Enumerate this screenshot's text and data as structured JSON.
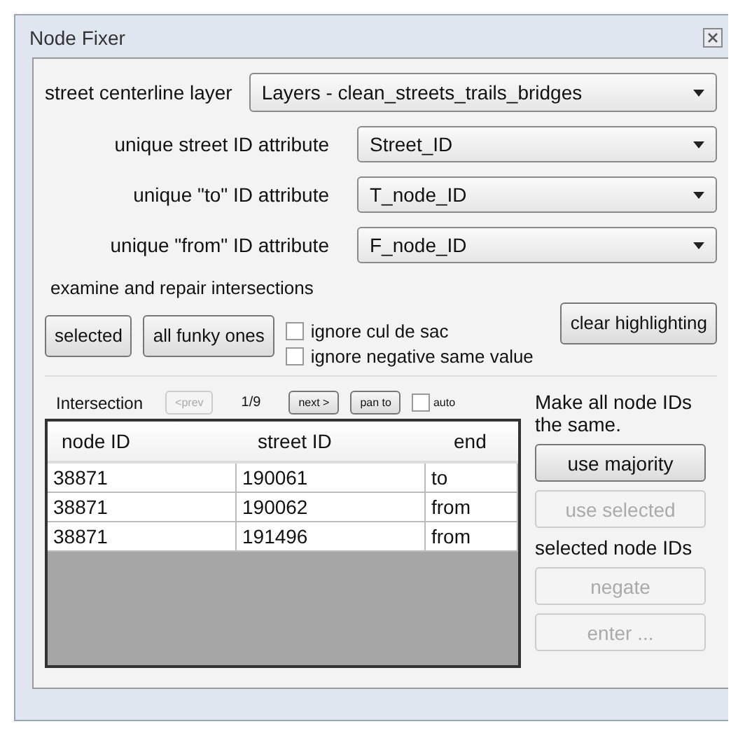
{
  "window": {
    "title": "Node Fixer"
  },
  "layer": {
    "label": "street centerline layer",
    "value": "Layers - clean_streets_trails_bridges"
  },
  "attributes": [
    {
      "label": "unique street ID attribute",
      "value": "Street_ID"
    },
    {
      "label": "unique \"to\" ID attribute",
      "value": "T_node_ID"
    },
    {
      "label": "unique \"from\" ID attribute",
      "value": "F_node_ID"
    }
  ],
  "examine": {
    "title": "examine and repair intersections",
    "buttons": [
      {
        "label": "selected",
        "disabled": false
      },
      {
        "label": "all funky ones",
        "disabled": false
      }
    ],
    "options": [
      {
        "label": "ignore cul de sac",
        "checked": false
      },
      {
        "label": "ignore negative same value",
        "checked": false
      }
    ],
    "clear_button": {
      "label": "clear highlighting",
      "disabled": false
    }
  },
  "intersection": {
    "title": "Intersection",
    "prev": {
      "label": "<prev",
      "disabled": true
    },
    "position": "1/9",
    "next": {
      "label": "next >",
      "disabled": false
    },
    "pan": {
      "label": "pan to",
      "disabled": false
    },
    "auto": {
      "label": "auto",
      "checked": false
    }
  },
  "table": {
    "columns": [
      "node ID",
      "street ID",
      "end"
    ],
    "rows": [
      [
        "38871",
        "190061",
        "to"
      ],
      [
        "38871",
        "190062",
        "from"
      ],
      [
        "38871",
        "191496",
        "from"
      ]
    ]
  },
  "same_ids": {
    "title": "Make all node IDs the same.",
    "buttons": [
      {
        "label": "use majority",
        "disabled": false
      },
      {
        "label": "use selected",
        "disabled": true
      }
    ]
  },
  "selected_ids": {
    "title": "selected node IDs",
    "buttons": [
      {
        "label": "negate",
        "disabled": true
      },
      {
        "label": "enter ...",
        "disabled": true
      }
    ]
  }
}
